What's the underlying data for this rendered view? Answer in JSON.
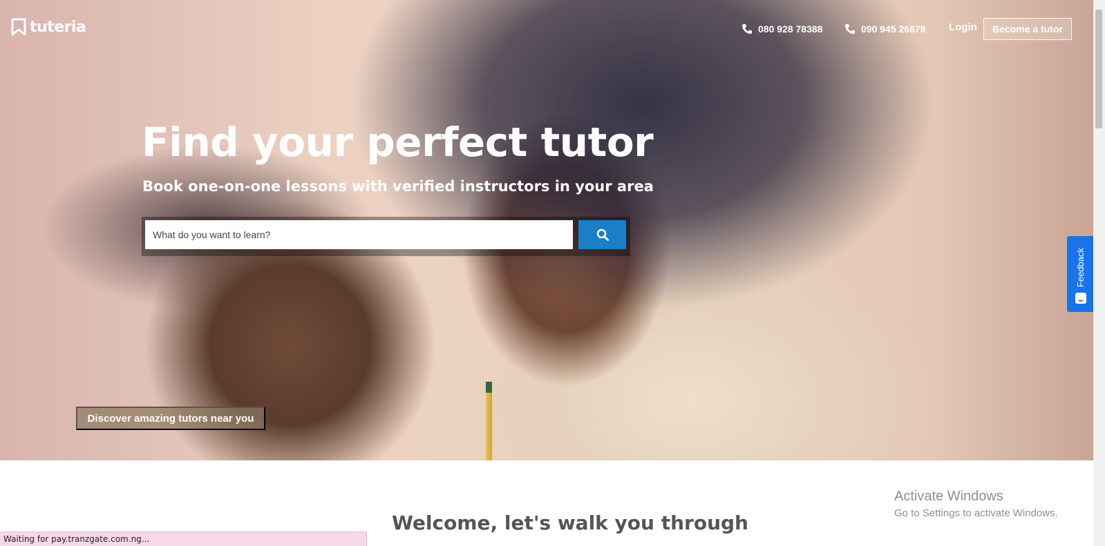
{
  "header": {
    "logo_text": "tuteria",
    "phone_1": "080 928 78388",
    "phone_2": "090 945 26878",
    "login_label": "Login",
    "become_tutor_label": "Become a tutor"
  },
  "hero": {
    "headline": "Find your perfect tutor",
    "subheadline": "Book one-on-one lessons with verified instructors in your area",
    "search_placeholder": "What do you want to learn?",
    "search_icon": "search-icon",
    "discover_label": "Discover amazing tutors near you"
  },
  "feedback": {
    "label": "Feedback"
  },
  "section": {
    "welcome_title": "Welcome, let's walk you through"
  },
  "os_overlay": {
    "activate_title": "Activate Windows",
    "activate_subtitle": "Go to Settings to activate Windows."
  },
  "status_bar": {
    "text": "Waiting for pay.tranzgate.com.ng..."
  },
  "colors": {
    "search_button": "#1a7fc4",
    "feedback_tab": "#1a73e8",
    "status_bar_bg": "#f7d8e7"
  }
}
